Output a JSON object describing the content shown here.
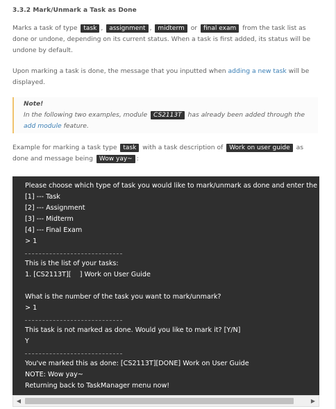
{
  "section": {
    "title": "3.3.2 Mark/Unmark a Task as Done"
  },
  "intro": {
    "t1": "Marks a task of type",
    "c1": "task",
    "sep1": ",",
    "c2": "assignment",
    "sep2": ",",
    "c3": "midterm",
    "or": "or",
    "c4": "final exam",
    "t2": "from the task list as done or undone, depending on its current status. When a task is first added, its status will be undone by default."
  },
  "message_para": {
    "t1": "Upon marking a task is done, the message that you inputted when",
    "link": "adding a new task",
    "t2": "will be displayed."
  },
  "note": {
    "title": "Note!",
    "t1": "In the following two examples, module",
    "code": "CS2113T",
    "t2": "has already been added through the",
    "link": "add module",
    "t3": "feature."
  },
  "example_para": {
    "t1": "Example for marking a task type",
    "c1": "task",
    "t2": "with a task description of",
    "c2": "Work on user guide",
    "t3": "as done and message being",
    "c3": "Wow yay~",
    "t4": ":"
  },
  "terminal": {
    "lines": [
      "Please choose which type of task you would like to mark/unmark as done and enter the n",
      "[1] --- Task",
      "[2] --- Assignment",
      "[3] --- Midterm",
      "[4] --- Final Exam",
      "> 1",
      "---",
      "This is the list of your tasks:",
      "1. [CS2113T][    ] Work on User Guide",
      "",
      "What is the number of the task you want to mark/unmark?",
      "> 1",
      "---",
      "This task is not marked as done. Would you like to mark it? [Y/N]",
      "Y",
      "---",
      "You've marked this as done: [CS2113T][DONE] Work on User Guide",
      "NOTE: Wow yay~",
      "Returning back to TaskManager menu now!"
    ]
  },
  "scrollbar": {
    "left_icon": "triangle-left-icon",
    "right_icon": "triangle-right-icon"
  }
}
